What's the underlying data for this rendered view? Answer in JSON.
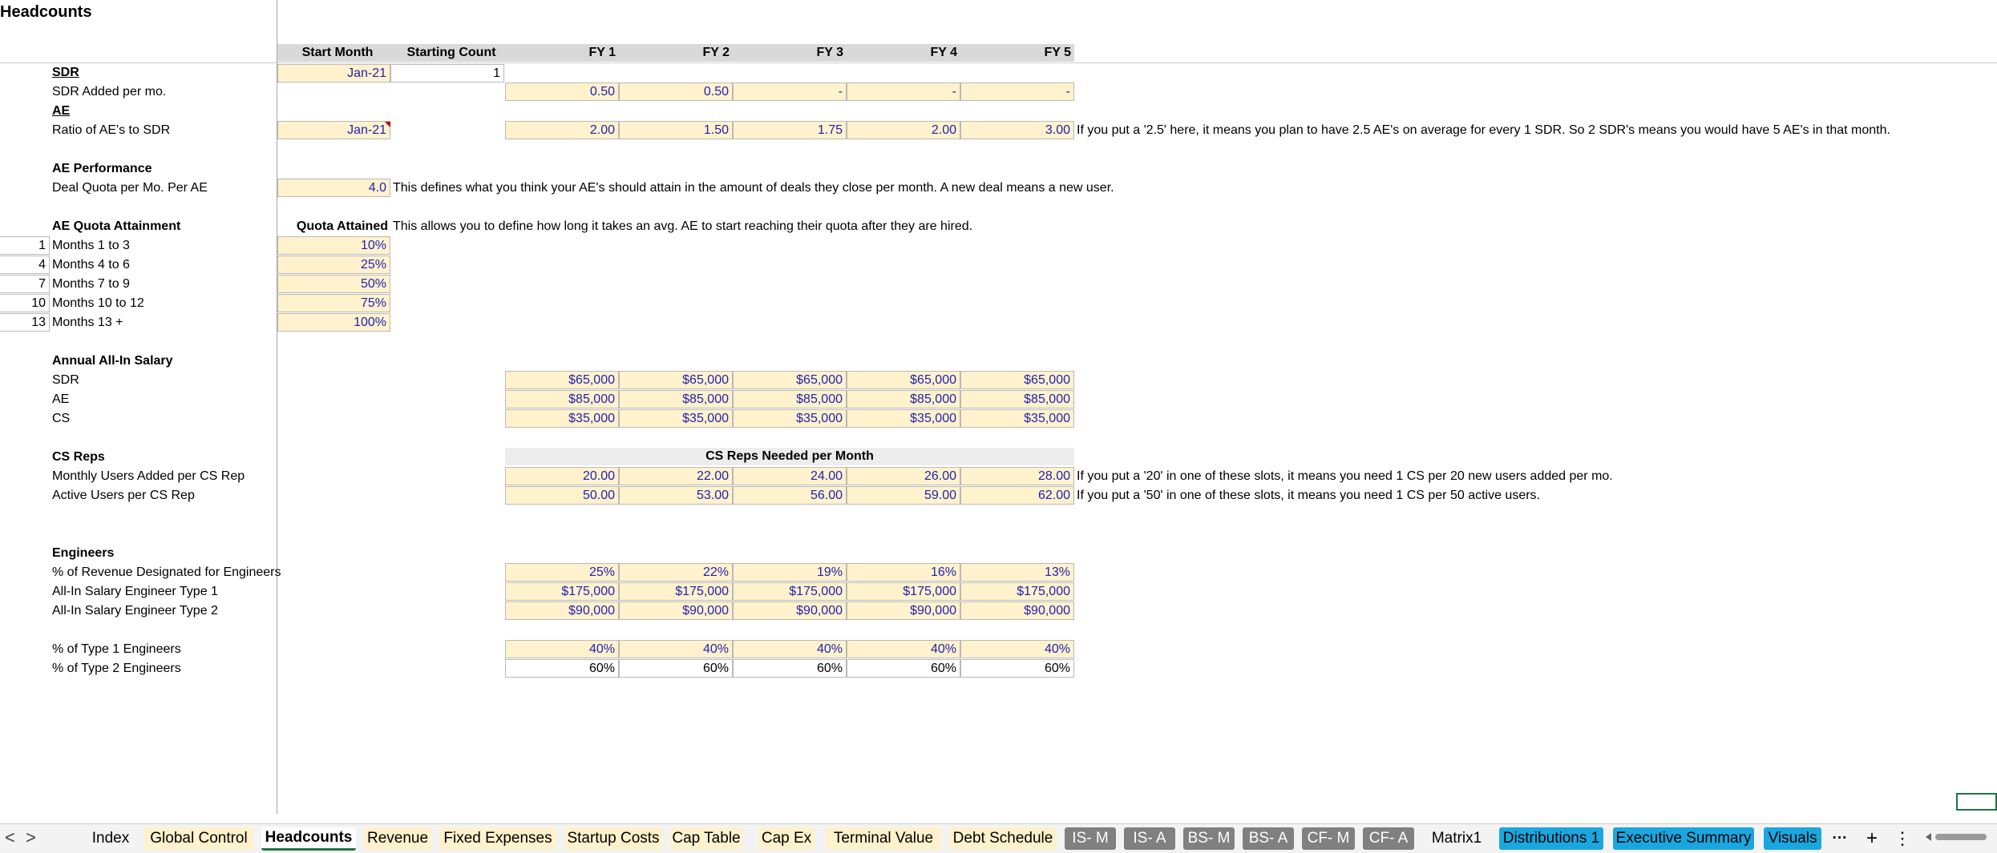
{
  "sheet_title": "Headcounts",
  "header": {
    "start_month": "Start Month",
    "starting_count": "Starting Count",
    "fy": [
      "FY 1",
      "FY 2",
      "FY 3",
      "FY 4",
      "FY 5"
    ]
  },
  "sdr": {
    "label": "SDR",
    "start_month": "Jan-21",
    "starting_count": "1",
    "added_label": "SDR Added per mo.",
    "added": [
      "0.50",
      "0.50",
      "-",
      "-",
      "-"
    ]
  },
  "ae": {
    "label": "AE",
    "ratio_label": "Ratio of AE's to SDR",
    "start_month": "Jan-21",
    "ratio": [
      "2.00",
      "1.50",
      "1.75",
      "2.00",
      "3.00"
    ],
    "note": "If you put a '2.5' here, it means you plan to have 2.5 AE's on average for every 1 SDR. So 2 SDR's means you would have 5 AE's in that month."
  },
  "ae_performance": {
    "label": "AE Performance",
    "quota_label": "Deal Quota per Mo. Per AE",
    "quota_value": "4.0",
    "note": "This defines what you think your AE's should attain in the amount of deals they close per month. A new deal means a new user."
  },
  "quota_attainment": {
    "label": "AE Quota Attainment",
    "column_label": "Quota Attained",
    "note": "This allows you to define how long it takes an avg. AE to start reaching their quota after they are hired.",
    "rows": [
      {
        "month": "1",
        "label": "Months 1 to 3",
        "value": "10%"
      },
      {
        "month": "4",
        "label": "Months 4 to 6",
        "value": "25%"
      },
      {
        "month": "7",
        "label": "Months 7 to 9",
        "value": "50%"
      },
      {
        "month": "10",
        "label": "Months 10 to 12",
        "value": "75%"
      },
      {
        "month": "13",
        "label": "Months 13 +",
        "value": "100%"
      }
    ]
  },
  "salary": {
    "label": "Annual All-In Salary",
    "rows": [
      {
        "label": "SDR",
        "values": [
          "$65,000",
          "$65,000",
          "$65,000",
          "$65,000",
          "$65,000"
        ]
      },
      {
        "label": "AE",
        "values": [
          "$85,000",
          "$85,000",
          "$85,000",
          "$85,000",
          "$85,000"
        ]
      },
      {
        "label": "CS",
        "values": [
          "$35,000",
          "$35,000",
          "$35,000",
          "$35,000",
          "$35,000"
        ]
      }
    ]
  },
  "cs_reps": {
    "label": "CS Reps",
    "band_label": "CS Reps Needed per Month",
    "rows": [
      {
        "label": "Monthly Users Added per CS Rep",
        "values": [
          "20.00",
          "22.00",
          "24.00",
          "26.00",
          "28.00"
        ],
        "note": "If you put a '20' in one of these slots, it means you need 1 CS per 20 new users added per mo."
      },
      {
        "label": "Active Users per CS Rep",
        "values": [
          "50.00",
          "53.00",
          "56.00",
          "59.00",
          "62.00"
        ],
        "note": "If you put a '50' in one of these slots, it means you need 1 CS per 50 active users."
      }
    ]
  },
  "engineers": {
    "label": "Engineers",
    "rows": [
      {
        "label": "% of Revenue Designated for Engineers",
        "values": [
          "25%",
          "22%",
          "19%",
          "16%",
          "13%"
        ]
      },
      {
        "label": "All-In Salary Engineer Type 1",
        "values": [
          "$175,000",
          "$175,000",
          "$175,000",
          "$175,000",
          "$175,000"
        ]
      },
      {
        "label": "All-In Salary Engineer Type 2",
        "values": [
          "$90,000",
          "$90,000",
          "$90,000",
          "$90,000",
          "$90,000"
        ]
      }
    ],
    "type_rows": [
      {
        "label": "% of Type 1 Engineers",
        "values": [
          "40%",
          "40%",
          "40%",
          "40%",
          "40%"
        ]
      },
      {
        "label": "% of Type 2 Engineers",
        "values": [
          "60%",
          "60%",
          "60%",
          "60%",
          "60%"
        ]
      }
    ]
  },
  "tabs": {
    "nav_prev": "<",
    "nav_next": ">",
    "items": [
      {
        "label": "Index",
        "style": "w"
      },
      {
        "label": "Global Control",
        "style": "y"
      },
      {
        "label": "Headcounts",
        "style": "active"
      },
      {
        "label": "Revenue",
        "style": "y"
      },
      {
        "label": "Fixed Expenses",
        "style": "y"
      },
      {
        "label": "Startup Costs",
        "style": "y"
      },
      {
        "label": "Cap Table",
        "style": "y"
      },
      {
        "label": "Cap Ex",
        "style": "y"
      },
      {
        "label": "Terminal Value",
        "style": "y"
      },
      {
        "label": "Debt Schedule",
        "style": "y"
      },
      {
        "label": "IS- M",
        "style": "g"
      },
      {
        "label": "IS- A",
        "style": "g"
      },
      {
        "label": "BS- M",
        "style": "g"
      },
      {
        "label": "BS- A",
        "style": "g"
      },
      {
        "label": "CF- M",
        "style": "g"
      },
      {
        "label": "CF- A",
        "style": "g"
      },
      {
        "label": "Matrix1",
        "style": "w"
      },
      {
        "label": "Distributions 1",
        "style": "b"
      },
      {
        "label": "Executive Summary",
        "style": "b"
      },
      {
        "label": "Visuals",
        "style": "b"
      }
    ],
    "more": "···",
    "add": "+",
    "options": "⋮"
  },
  "colors": {
    "input_fill": "#fff2cc",
    "input_text": "#1f1fb4",
    "header_fill": "#d9d9d9",
    "active_tab_underline": "#217346",
    "tab_grey": "#808080",
    "tab_blue": "#1aa7e0"
  }
}
